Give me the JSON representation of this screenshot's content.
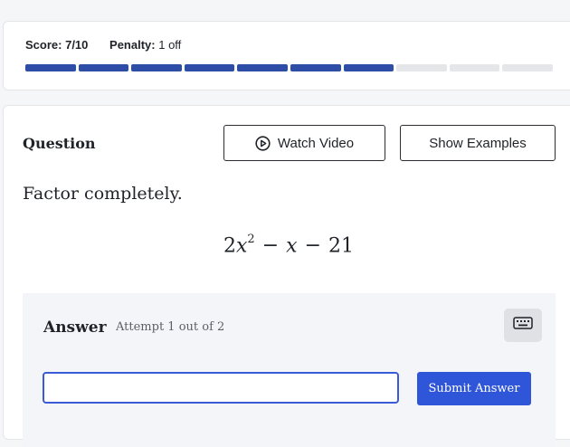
{
  "score": {
    "label": "Score:",
    "value": "7/10",
    "penalty_label": "Penalty:",
    "penalty_value": "1 off",
    "progress": {
      "total_segments": 10,
      "filled_segments": 7,
      "fill_color": "#2e4da7",
      "empty_color": "#e4e6ea"
    }
  },
  "question": {
    "title": "Question",
    "watch_video_label": "Watch Video",
    "show_examples_label": "Show Examples",
    "prompt": "Factor completely.",
    "expression": {
      "coef": "2",
      "var": "x",
      "exp": "2",
      "minus1": "−",
      "term2": "x",
      "minus2": "−",
      "const": "21"
    }
  },
  "answer": {
    "title": "Answer",
    "attempt": "Attempt 1 out of 2",
    "input_value": "",
    "submit_label": "Submit Answer",
    "keyboard_icon": "keyboard-icon"
  },
  "colors": {
    "accent": "#2f56d9",
    "input_border": "#3a5bd6"
  }
}
